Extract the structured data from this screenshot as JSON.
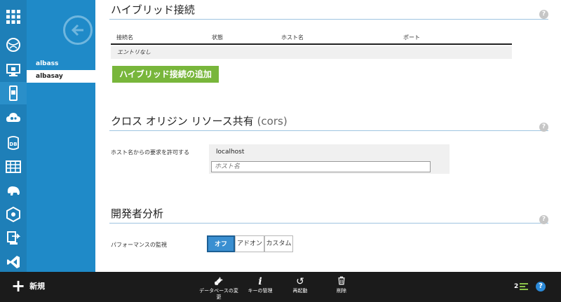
{
  "subnav": {
    "items": [
      "albass",
      "albasay"
    ]
  },
  "hybrid": {
    "title": "ハイブリッド接続",
    "columns": [
      "接続名",
      "状態",
      "ホスト名",
      "ポート"
    ],
    "empty_text": "エントリなし",
    "add_button": "ハイブリッド接続の追加"
  },
  "cors": {
    "title": "クロス オリジン リソース共有",
    "title_suffix": "(cors)",
    "label": "ホスト名からの要求を許可する",
    "value": "localhost",
    "input_placeholder": "ホスト名"
  },
  "analytics": {
    "title": "開発者分析",
    "label": "パフォーマンスの監視",
    "options": [
      "オフ",
      "アドオン",
      "カスタム"
    ],
    "selected": "オフ"
  },
  "help_glyph": "?",
  "bottombar": {
    "new_label": "新規",
    "commands": [
      {
        "label": "データベースの変更",
        "icon": "plug-icon"
      },
      {
        "label": "キーの管理",
        "icon": "info-icon"
      },
      {
        "label": "再起動",
        "icon": "restart-icon"
      },
      {
        "label": "削除",
        "icon": "trash-icon"
      }
    ],
    "page_count": "2",
    "help": "?"
  },
  "colors": {
    "rail": "#1e7fb8",
    "subnav": "#1f8ac8",
    "accent_green": "#78b63b",
    "toggle_active": "#3a8fd1",
    "bottombar": "#1b1b1b"
  }
}
